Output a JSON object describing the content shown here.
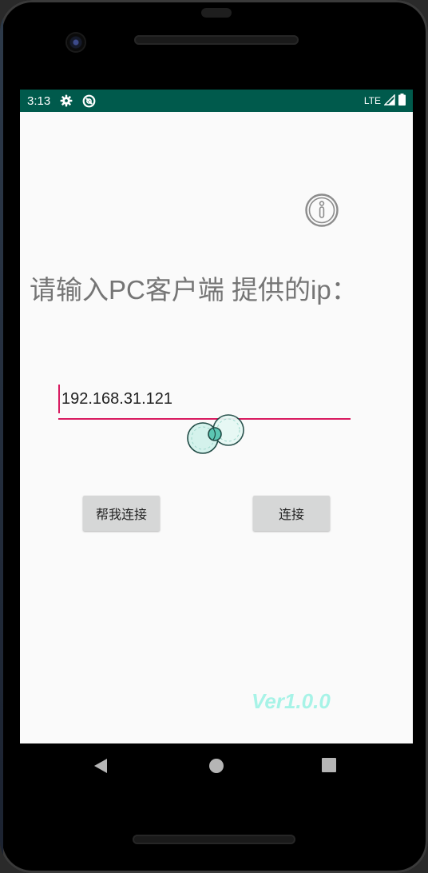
{
  "status_bar": {
    "time": "3:13",
    "icons": [
      "gear-icon",
      "sync-icon"
    ],
    "network_label": "LTE",
    "signal_icon": "signal-icon",
    "battery_icon": "battery-icon",
    "background_color": "#005a4c"
  },
  "main": {
    "info_icon": "info-icon",
    "prompt": "请输入PC客户端 提供的ip：",
    "ip_input": {
      "value": "192.168.31.121",
      "accent_color": "#d81b60"
    },
    "logo_icon": "bubbles-logo-icon",
    "buttons": {
      "help_connect_label": "帮我连接",
      "connect_label": "连接"
    },
    "version": "Ver1.0.0",
    "version_color": "#a7f3e7"
  },
  "nav_bar": {
    "back_icon": "back-icon",
    "home_icon": "home-icon",
    "recents_icon": "recents-icon"
  }
}
